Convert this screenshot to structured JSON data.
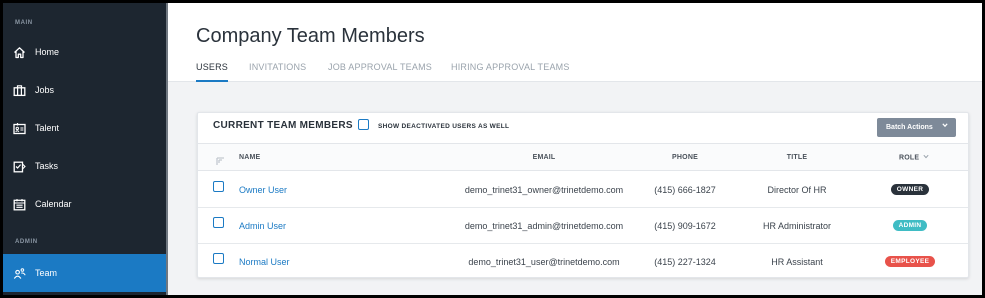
{
  "sidebar": {
    "sections": {
      "main": "MAIN",
      "admin": "ADMIN"
    },
    "items": [
      {
        "label": "Home",
        "icon": "home-icon"
      },
      {
        "label": "Jobs",
        "icon": "briefcase-icon"
      },
      {
        "label": "Talent",
        "icon": "id-card-icon"
      },
      {
        "label": "Tasks",
        "icon": "tasks-icon"
      },
      {
        "label": "Calendar",
        "icon": "calendar-icon"
      },
      {
        "label": "Team",
        "icon": "team-icon",
        "active": true
      }
    ]
  },
  "header": {
    "title": "Company Team Members",
    "tabs": [
      {
        "label": "USERS",
        "active": true
      },
      {
        "label": "INVITATIONS"
      },
      {
        "label": "JOB APPROVAL TEAMS"
      },
      {
        "label": "HIRING APPROVAL TEAMS"
      }
    ]
  },
  "card": {
    "title": "CURRENT TEAM MEMBERS",
    "show_deactivated_label": "SHOW DEACTIVATED USERS AS WELL",
    "show_deactivated_checked": false,
    "batch_actions_label": "Batch Actions"
  },
  "table": {
    "columns": {
      "name": "NAME",
      "email": "EMAIL",
      "phone": "PHONE",
      "title": "TITLE",
      "role": "ROLE"
    },
    "rows": [
      {
        "name": "Owner User",
        "email": "demo_trinet31_owner@trinetdemo.com",
        "phone": "(415) 666-1827",
        "title": "Director Of HR",
        "role": "OWNER",
        "role_color": "#2a323b"
      },
      {
        "name": "Admin User",
        "email": "demo_trinet31_admin@trinetdemo.com",
        "phone": "(415) 909-1672",
        "title": "HR Administrator",
        "role": "ADMIN",
        "role_color": "#3fbcc4"
      },
      {
        "name": "Normal User",
        "email": "demo_trinet31_user@trinetdemo.com",
        "phone": "(415) 227-1324",
        "title": "HR Assistant",
        "role": "EMPLOYEE",
        "role_color": "#e8524a"
      }
    ]
  },
  "colors": {
    "accent": "#1b7ac4",
    "sidebar_bg": "#1d2630"
  }
}
